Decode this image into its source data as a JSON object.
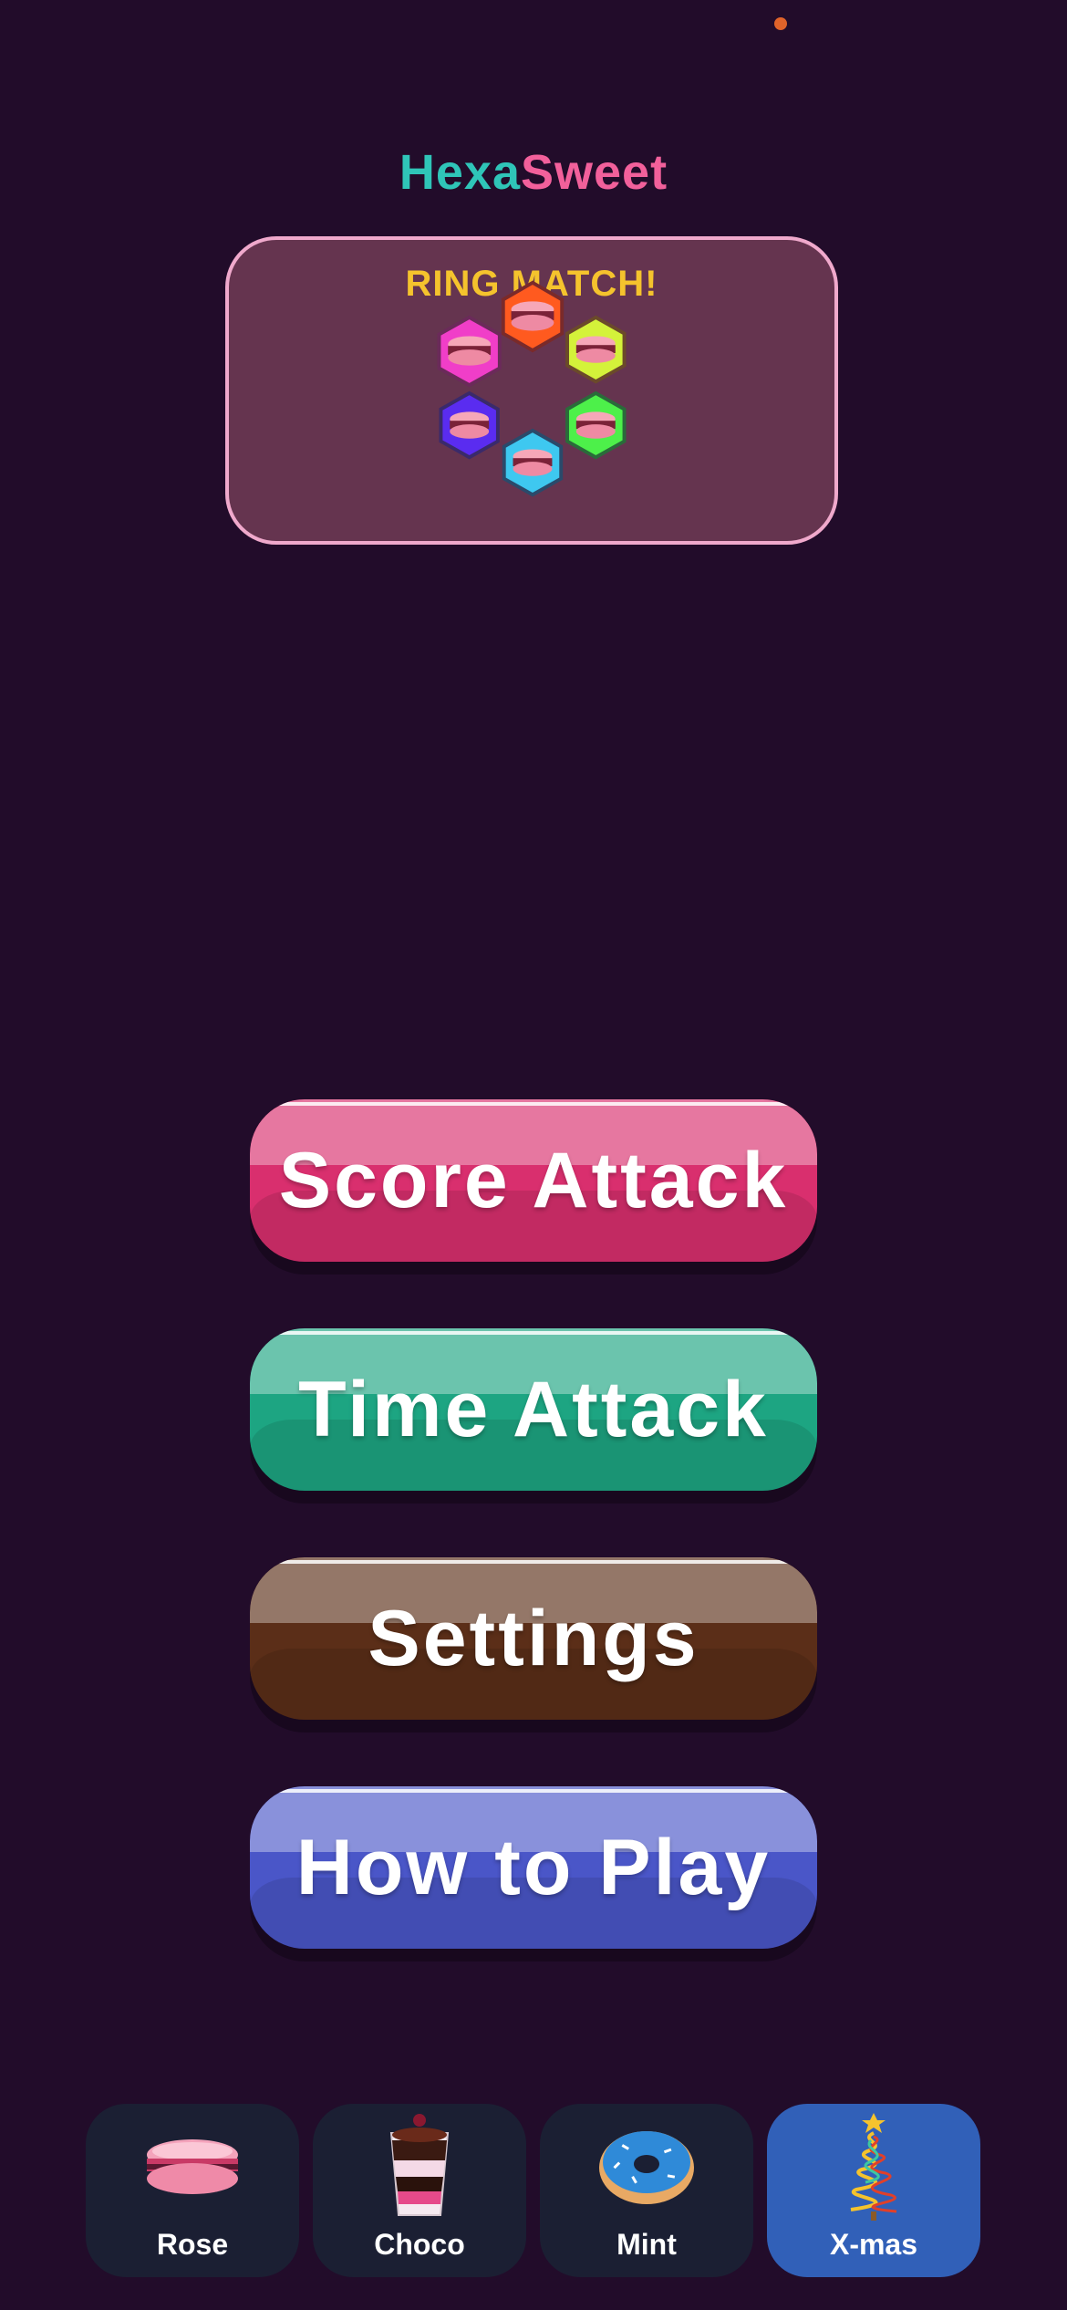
{
  "title": {
    "part1": "Hexa",
    "part2": "Sweet"
  },
  "preview": {
    "caption": "RING MATCH!",
    "hex_colors": [
      "#ff5a1f",
      "#d4f23a",
      "#4df04a",
      "#3ec8f0",
      "#5a2cf0",
      "#f03ec8"
    ]
  },
  "menu": {
    "score_attack": "Score Attack",
    "time_attack": "Time Attack",
    "settings": "Settings",
    "how_to_play": "How to Play"
  },
  "themes": [
    {
      "label": "Rose",
      "icon": "macaron-icon",
      "selected": false
    },
    {
      "label": "Choco",
      "icon": "parfait-icon",
      "selected": false
    },
    {
      "label": "Mint",
      "icon": "donut-icon",
      "selected": false
    },
    {
      "label": "X-mas",
      "icon": "christmas-tree-icon",
      "selected": true
    }
  ],
  "colors": {
    "background": "#220c2a",
    "accent_teal": "#2fc5b8",
    "accent_pink": "#f2609b",
    "caption_yellow": "#f5c32d",
    "score_button": "#d92f6e",
    "time_button": "#1da582",
    "settings_button": "#5b2e18",
    "howto_button": "#4a56c8",
    "theme_selected": "#3160b8"
  }
}
